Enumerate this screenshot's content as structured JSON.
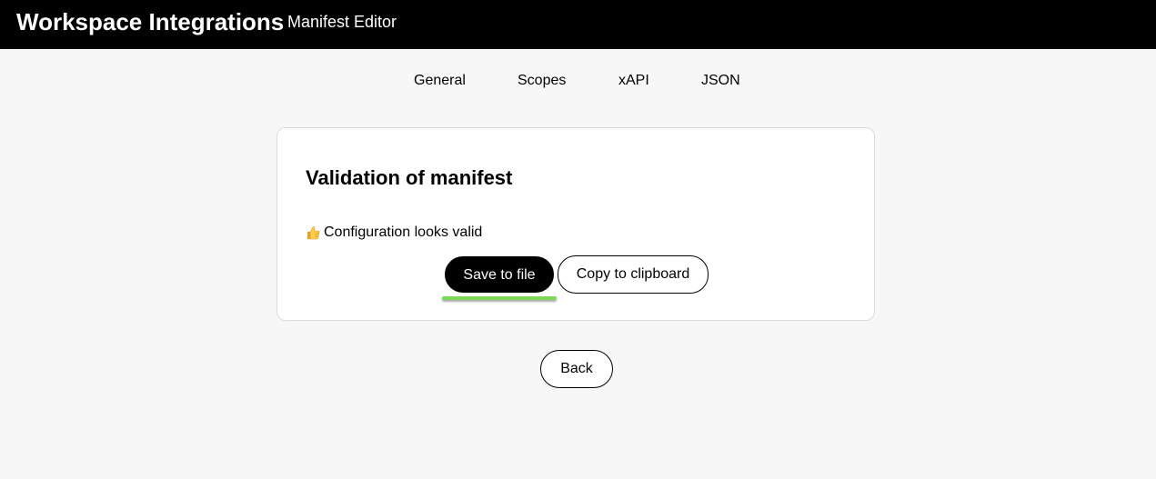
{
  "header": {
    "app_title": "Workspace Integrations",
    "subtitle": "Manifest Editor"
  },
  "tabs": [
    {
      "label": "General"
    },
    {
      "label": "Scopes"
    },
    {
      "label": "xAPI"
    },
    {
      "label": "JSON"
    }
  ],
  "card": {
    "title": "Validation of manifest",
    "status_icon": "thumbs-up-icon",
    "status_text": "Configuration looks valid",
    "save_label": "Save to file",
    "copy_label": "Copy to clipboard"
  },
  "back_label": "Back",
  "colors": {
    "header_bg": "#000000",
    "page_bg": "#f7f7f7",
    "highlight": "#7ed957"
  }
}
